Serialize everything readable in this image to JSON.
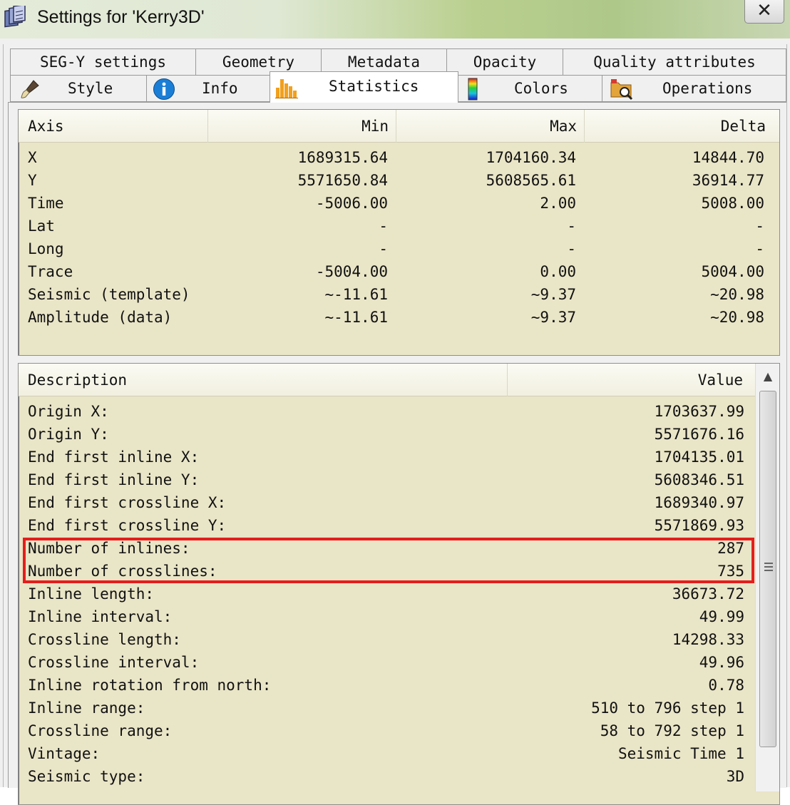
{
  "window": {
    "title": "Settings for 'Kerry3D'",
    "close_label": "✕"
  },
  "tabs": {
    "row1": [
      {
        "label": "SEG-Y settings"
      },
      {
        "label": "Geometry"
      },
      {
        "label": "Metadata"
      },
      {
        "label": "Opacity"
      },
      {
        "label": "Quality attributes"
      }
    ],
    "row2": [
      {
        "label": "Style",
        "icon": "brush-icon"
      },
      {
        "label": "Info",
        "icon": "info-icon"
      },
      {
        "label": "Statistics",
        "icon": "bar-chart-icon",
        "active": true
      },
      {
        "label": "Colors",
        "icon": "color-bar-icon"
      },
      {
        "label": "Operations",
        "icon": "folder-search-icon"
      }
    ]
  },
  "stats_table": {
    "headers": {
      "axis": "Axis",
      "min": "Min",
      "max": "Max",
      "delta": "Delta"
    },
    "rows": [
      {
        "axis": "X",
        "min": "1689315.64",
        "max": "1704160.34",
        "delta": "14844.70"
      },
      {
        "axis": "Y",
        "min": "5571650.84",
        "max": "5608565.61",
        "delta": "36914.77"
      },
      {
        "axis": "Time",
        "min": "-5006.00",
        "max": "2.00",
        "delta": "5008.00"
      },
      {
        "axis": "Lat",
        "min": "-",
        "max": "-",
        "delta": "-"
      },
      {
        "axis": "Long",
        "min": "-",
        "max": "-",
        "delta": "-"
      },
      {
        "axis": "Trace",
        "min": "-5004.00",
        "max": "0.00",
        "delta": "5004.00"
      },
      {
        "axis": "Seismic (template)",
        "min": "~-11.61",
        "max": "~9.37",
        "delta": "~20.98"
      },
      {
        "axis": "Amplitude (data)",
        "min": "~-11.61",
        "max": "~9.37",
        "delta": "~20.98"
      }
    ]
  },
  "desc_table": {
    "headers": {
      "description": "Description",
      "value": "Value"
    },
    "rows": [
      {
        "description": "Origin X:",
        "value": "1703637.99"
      },
      {
        "description": "Origin Y:",
        "value": "5571676.16"
      },
      {
        "description": "End first inline X:",
        "value": "1704135.01"
      },
      {
        "description": "End first inline Y:",
        "value": "5608346.51"
      },
      {
        "description": "End first crossline X:",
        "value": "1689340.97"
      },
      {
        "description": "End first crossline Y:",
        "value": "5571869.93"
      },
      {
        "description": "Number of inlines:",
        "value": "287"
      },
      {
        "description": "Number of crosslines:",
        "value": "735"
      },
      {
        "description": "Inline length:",
        "value": "36673.72"
      },
      {
        "description": "Inline interval:",
        "value": "49.99"
      },
      {
        "description": "Crossline length:",
        "value": "14298.33"
      },
      {
        "description": "Crossline interval:",
        "value": "49.96"
      },
      {
        "description": "Inline rotation from north:",
        "value": "0.78"
      },
      {
        "description": "Inline range:",
        "value": "510 to 796 step 1"
      },
      {
        "description": "Crossline range:",
        "value": "58 to 792 step 1"
      },
      {
        "description": "Vintage:",
        "value": "Seismic Time 1"
      },
      {
        "description": "Seismic type:",
        "value": "3D"
      }
    ]
  },
  "colors": {
    "panel_bg": "#e9e5c7",
    "highlight": "#e51d1d"
  }
}
